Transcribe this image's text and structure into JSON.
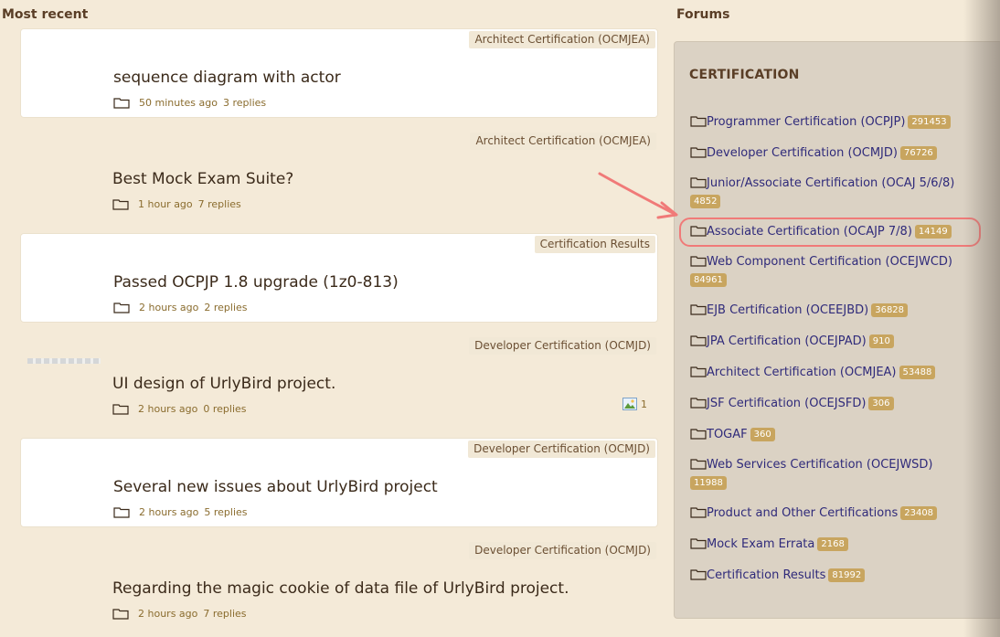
{
  "most_recent": {
    "heading": "Most recent",
    "posts": [
      {
        "forum": "Architect Certification (OCMJEA)",
        "title": "sequence diagram with actor",
        "time": "50 minutes ago",
        "replies": "3 replies",
        "style": "white"
      },
      {
        "forum": "Architect Certification (OCMJEA)",
        "title": "Best Mock Exam Suite?",
        "time": "1 hour ago",
        "replies": "7 replies",
        "style": "plain"
      },
      {
        "forum": "Certification Results",
        "title": "Passed OCPJP 1.8 upgrade (1z0-813)",
        "time": "2 hours ago",
        "replies": "2 replies",
        "style": "white"
      },
      {
        "forum": "Developer Certification (OCMJD)",
        "title": "UI design of UrlyBird project.",
        "time": "2 hours ago",
        "replies": "0 replies",
        "style": "plain",
        "attachments": "1"
      },
      {
        "forum": "Developer Certification (OCMJD)",
        "title": "Several new issues about UrlyBird project",
        "time": "2 hours ago",
        "replies": "5 replies",
        "style": "white"
      },
      {
        "forum": "Developer Certification (OCMJD)",
        "title": "Regarding the magic cookie of data file of UrlyBird project.",
        "time": "2 hours ago",
        "replies": "7 replies",
        "style": "plain"
      }
    ]
  },
  "forums": {
    "heading": "Forums",
    "category": "CERTIFICATION",
    "items": [
      {
        "name": "Programmer Certification (OCPJP)",
        "count": "291453"
      },
      {
        "name": "Developer Certification (OCMJD)",
        "count": "76726"
      },
      {
        "name": "Junior/Associate Certification (OCAJ 5/6/8)",
        "count": "4852"
      },
      {
        "name": "Associate Certification (OCAJP 7/8)",
        "count": "14149"
      },
      {
        "name": "Web Component Certification (OCEJWCD)",
        "count": "84961"
      },
      {
        "name": "EJB Certification (OCEEJBD)",
        "count": "36828"
      },
      {
        "name": "JPA Certification (OCEJPAD)",
        "count": "910"
      },
      {
        "name": "Architect Certification (OCMJEA)",
        "count": "53488"
      },
      {
        "name": "JSF Certification (OCEJSFD)",
        "count": "306"
      },
      {
        "name": "TOGAF",
        "count": "360"
      },
      {
        "name": "Web Services Certification (OCEJWSD)",
        "count": "11988"
      },
      {
        "name": "Product and Other Certifications",
        "count": "23408"
      },
      {
        "name": "Mock Exam Errata",
        "count": "2168"
      },
      {
        "name": "Certification Results",
        "count": "81992"
      }
    ]
  },
  "colors": {
    "background": "#f4ead8",
    "link": "#2f2a7a",
    "count_badge": "#c8a55f",
    "highlight": "#f07a78"
  }
}
